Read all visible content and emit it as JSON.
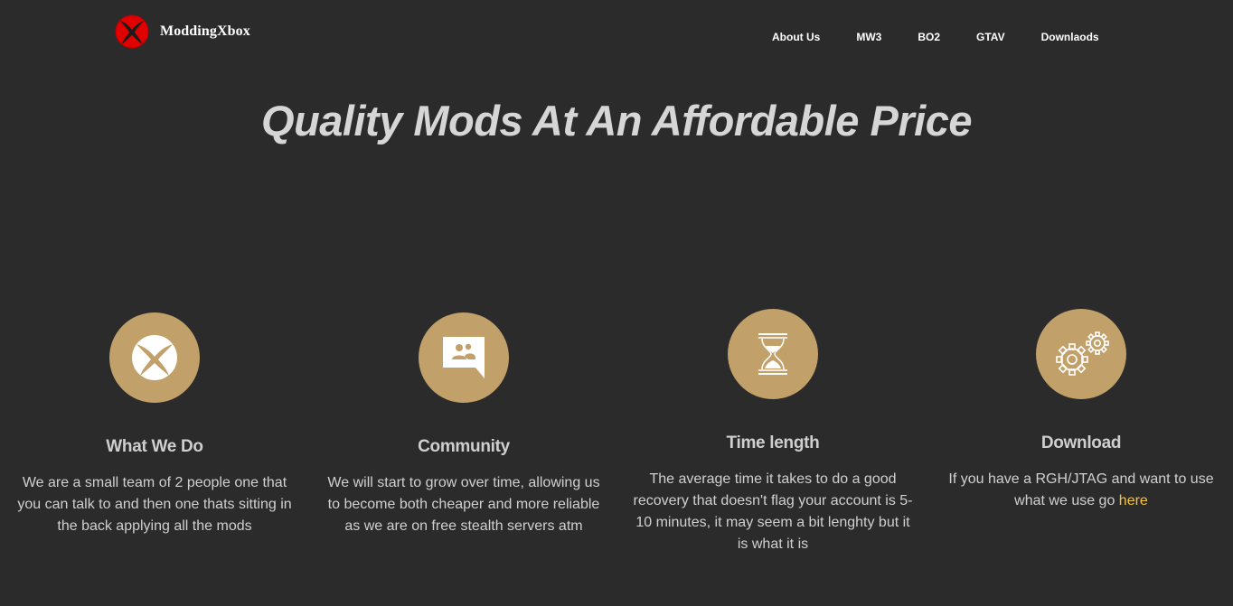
{
  "header": {
    "brand_name": "ModdingXbox",
    "logo_icon": "xbox-logo-icon",
    "brand_color": "#e00000",
    "nav": [
      {
        "label": "About Us"
      },
      {
        "label": "MW3"
      },
      {
        "label": "BO2"
      },
      {
        "label": "GTAV"
      },
      {
        "label": "Downlaods"
      }
    ]
  },
  "hero": {
    "title": "Quality Mods At An Affordable Price"
  },
  "theme": {
    "background": "#2b2b2b",
    "accent": "#c2a06a",
    "link": "#f4c33f"
  },
  "features": [
    {
      "icon": "xbox-icon",
      "title": "What We Do",
      "text": "We are a small team of 2 people one that you can talk to and then one thats sitting in the back applying all the mods"
    },
    {
      "icon": "chat-people-icon",
      "title": "Community",
      "text": "We will start to grow over time, allowing us to become both cheaper and more reliable as we are on free stealth servers atm"
    },
    {
      "icon": "hourglass-icon",
      "title": "Time length",
      "text": "The average time it takes to do a good recovery that doesn't flag your account is 5-10 minutes, it may seem a bit lenghty but it is what it is"
    },
    {
      "icon": "gears-icon",
      "title": "Download",
      "text_before": "If you have a RGH/JTAG and want to use what we use go ",
      "link_text": "here"
    }
  ]
}
